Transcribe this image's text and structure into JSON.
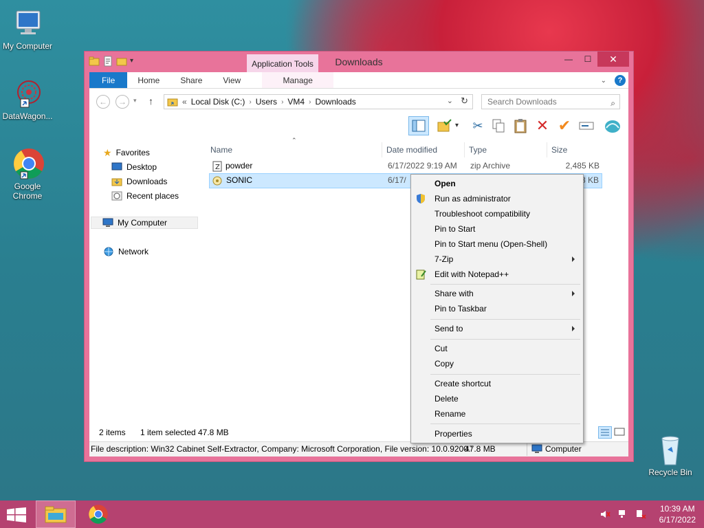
{
  "desktop": {
    "icons": [
      {
        "label": "My Computer"
      },
      {
        "label": "DataWagon..."
      },
      {
        "label": "Google Chrome"
      },
      {
        "label": "Recycle Bin"
      }
    ]
  },
  "window": {
    "title": "Downloads",
    "contextual_tab_group": "Application Tools",
    "ribbon_tabs": [
      "File",
      "Home",
      "Share",
      "View",
      "Manage"
    ],
    "address": {
      "overflow": "«",
      "segments": [
        "Local Disk (C:)",
        "Users",
        "VM4",
        "Downloads"
      ]
    },
    "search_placeholder": "Search Downloads",
    "nav": {
      "favorites": "Favorites",
      "desktop": "Desktop",
      "downloads": "Downloads",
      "recent": "Recent places",
      "my_computer": "My Computer",
      "network": "Network"
    },
    "columns": {
      "name": "Name",
      "date": "Date modified",
      "type": "Type",
      "size": "Size"
    },
    "files": [
      {
        "name": "powder",
        "date": "6/17/2022 9:19 AM",
        "type": "zip Archive",
        "size": "2,485 KB"
      },
      {
        "name": "SONIC",
        "date": "6/17/",
        "type": "",
        "size": "8 KB"
      }
    ],
    "status": {
      "items": "2 items",
      "selected": "1 item selected",
      "selected_size": "47.8 MB"
    },
    "details": {
      "description": "File description: Win32 Cabinet Self-Extractor, Company: Microsoft Corporation, File version: 10.0.9200.'",
      "size": "47.8 MB",
      "location": "Computer"
    }
  },
  "context_menu": {
    "open": "Open",
    "run_admin": "Run as administrator",
    "troubleshoot": "Troubleshoot compatibility",
    "pin_start": "Pin to Start",
    "pin_start_menu": "Pin to Start menu (Open-Shell)",
    "seven_zip": "7-Zip",
    "notepad": "Edit with Notepad++",
    "share_with": "Share with",
    "pin_taskbar": "Pin to Taskbar",
    "send_to": "Send to",
    "cut": "Cut",
    "copy": "Copy",
    "create_shortcut": "Create shortcut",
    "delete": "Delete",
    "rename": "Rename",
    "properties": "Properties"
  },
  "taskbar": {
    "time": "10:39 AM",
    "date": "6/17/2022"
  },
  "colors": {
    "window_frame": "#e8739a",
    "taskbar": "#b54270",
    "file_tab": "#1979ca",
    "selection": "#cce8ff"
  }
}
